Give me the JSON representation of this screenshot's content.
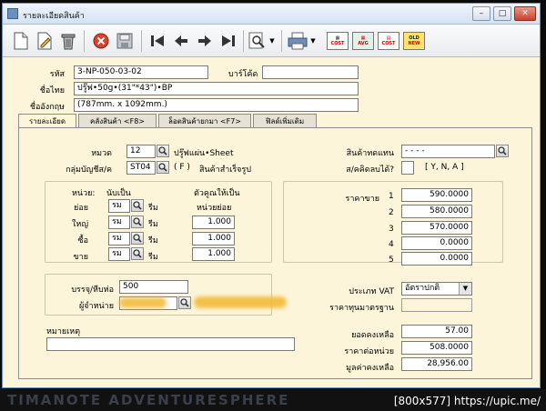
{
  "window": {
    "title": "รายละเอียดสินค้า",
    "buttons": {
      "minimize": "–",
      "maximize": "□",
      "close": "✕"
    }
  },
  "toolbar": {
    "buttons": [
      "new-doc-icon",
      "edit-icon",
      "delete-icon",
      "cancel-icon",
      "save-icon",
      "first-icon",
      "prev-icon",
      "next-icon",
      "last-icon",
      "search-icon",
      "print-icon",
      "cost-report-icon",
      "avg-cost-icon",
      "old-new-icon"
    ],
    "labels": {
      "cost_report": "COST",
      "avg_cost": "AVG",
      "old_new_old": "OLD",
      "old_new_new": "NEW"
    }
  },
  "header": {
    "code_label": "รหัส",
    "code_value": "3-NP-050-03-02",
    "barcode_label": "บาร์โค้ด",
    "barcode_value": "",
    "thai_name_label": "ชื่อไทย",
    "thai_name_value": "ปรู๊ฟ•50g•(31\"*43\")•BP",
    "eng_name_label": "ชื่ออังกฤษ",
    "eng_name_value": "(787mm. x 1092mm.)"
  },
  "tabs": [
    {
      "label": "รายละเอียด"
    },
    {
      "label": "คลังสินค้า <F8>"
    },
    {
      "label": "ล็อตสินค้ายกมา <F7>"
    },
    {
      "label": "ฟิลด์เพิ่มเติม"
    }
  ],
  "detail": {
    "category_label": "หมวด",
    "category_code": "12",
    "category_name": "ปรู๊ฟแผ่น•Sheet",
    "account_group_label": "กลุ่มบัญชีส/ค",
    "account_group_code": "ST04",
    "account_group_type": "( F )",
    "account_group_name": "สินค้าสำเร็จรูป",
    "substitute_label": "สินค้าทดแทน",
    "substitute_value": "-   -   -   -",
    "calc_label": "ส/คคิดลบได้?",
    "calc_value": "",
    "calc_hint": "[ Y, N, A ]"
  },
  "units": {
    "unit_header": "หน่วย:",
    "count_header": "นับเป็น",
    "multiplier_header": "ตัวคูณให้เป็น",
    "sub_unit_header": "หน่วยย่อย",
    "rows": [
      {
        "label": "ย่อย",
        "unit": "รม",
        "name": "รีม",
        "multiplier": ""
      },
      {
        "label": "ใหญ่",
        "unit": "รม",
        "name": "รีม",
        "multiplier": "1.000"
      },
      {
        "label": "ซื้อ",
        "unit": "รม",
        "name": "รีม",
        "multiplier": "1.000"
      },
      {
        "label": "ขาย",
        "unit": "รม",
        "name": "รีม",
        "multiplier": "1.000"
      }
    ]
  },
  "prices": {
    "label": "ราคาขาย",
    "rows": [
      {
        "index": "1",
        "value": "590.0000"
      },
      {
        "index": "2",
        "value": "580.0000"
      },
      {
        "index": "3",
        "value": "570.0000"
      },
      {
        "index": "4",
        "value": "0.0000"
      },
      {
        "index": "5",
        "value": "0.0000"
      }
    ]
  },
  "packaging": {
    "pack_label": "บรรจุ/หีบห่อ",
    "pack_value": "500",
    "supplier_label": "ผู้จำหน่าย",
    "supplier_value": ""
  },
  "vat": {
    "type_label": "ประเภท VAT",
    "type_value": "อัตราปกติ",
    "standard_price_label": "ราคาทุนมาตรฐาน",
    "standard_price_value": ""
  },
  "note": {
    "label": "หมายเหตุ",
    "value": ""
  },
  "summary": {
    "balance_label": "ยอดคงเหลือ",
    "balance_value": "57.00",
    "unit_cost_label": "ราคาต่อหน่วย",
    "unit_cost_value": "508.0000",
    "total_value_label": "มูลค่าคงเหลือ",
    "total_value_value": "28,956.00"
  },
  "footer": {
    "credit": "[800x577] https://upic.me/",
    "background_text": "TIMANOTE ADVENTURESPHERE"
  }
}
